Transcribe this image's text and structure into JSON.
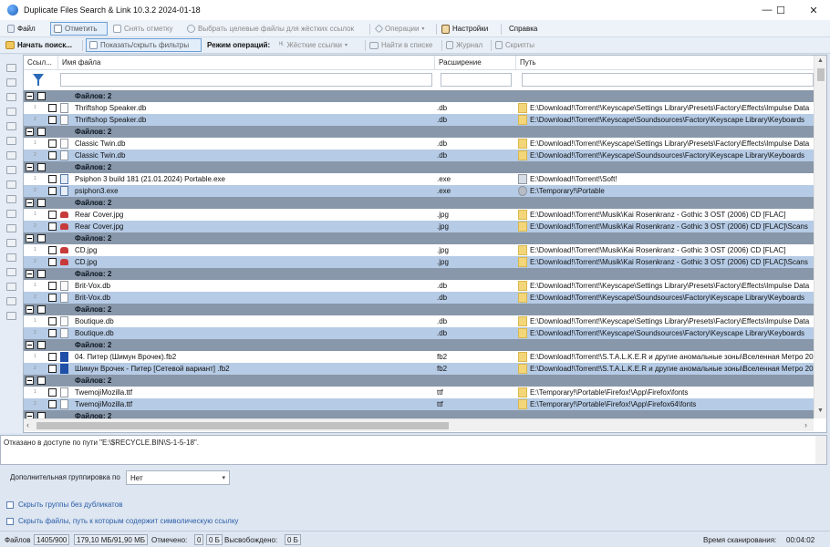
{
  "window": {
    "title": "Duplicate Files Search & Link 10.3.2 2024-01-18",
    "minimize": "—",
    "maximize": "☐",
    "close": "✕"
  },
  "menu": {
    "file": "Файл",
    "mark": "Отметить",
    "unmark": "Снять отметку",
    "select_targets": "Выбрать целевые файлы для жёстких ссылок",
    "operations": "Операции",
    "settings": "Настройки",
    "help": "Справка"
  },
  "toolbar": {
    "start_search": "Начать поиск...",
    "toggle_filters": "Показать/скрыть фильтры",
    "mode_label": "Режим операций:",
    "hard_links": "Жёсткие ссылки",
    "find_in_list": "Найти в списке",
    "journal": "Журнал",
    "scripts": "Скрипты"
  },
  "grid": {
    "columns": {
      "links": "Ссыл...",
      "filename": "Имя файла",
      "extension": "Расширение",
      "path": "Путь"
    },
    "group_label": "Файлов: 2",
    "rows": [
      {
        "type": "group",
        "label": "Файлов: 2"
      },
      {
        "type": "file",
        "num": "1",
        "icon": "db",
        "name": "Thriftshop Speaker.db",
        "ext": ".db",
        "path_icon": "folder",
        "path": "E:\\Download!\\Torrent!\\Keyscape\\Settings Library\\Presets\\Factory\\Effects\\Impulse Data"
      },
      {
        "type": "file",
        "num": "2",
        "icon": "db",
        "name": "Thriftshop Speaker.db",
        "ext": ".db",
        "path_icon": "folder",
        "path": "E:\\Download!\\Torrent!\\Keyscape\\Soundsources\\Factory\\Keyscape Library\\Keyboards"
      },
      {
        "type": "group",
        "label": "Файлов: 2"
      },
      {
        "type": "file",
        "num": "1",
        "icon": "db",
        "name": "Classic Twin.db",
        "ext": ".db",
        "path_icon": "folder",
        "path": "E:\\Download!\\Torrent!\\Keyscape\\Settings Library\\Presets\\Factory\\Effects\\Impulse Data"
      },
      {
        "type": "file",
        "num": "2",
        "icon": "db",
        "name": "Classic Twin.db",
        "ext": ".db",
        "path_icon": "folder",
        "path": "E:\\Download!\\Torrent!\\Keyscape\\Soundsources\\Factory\\Keyscape Library\\Keyboards"
      },
      {
        "type": "group",
        "label": "Файлов: 2"
      },
      {
        "type": "file",
        "num": "1",
        "icon": "exe",
        "name": "Psiphon 3 build 181 (21.01.2024) Portable.exe",
        "ext": ".exe",
        "path_icon": "app",
        "path": "E:\\Download!\\Torrent!\\Soft!"
      },
      {
        "type": "file",
        "num": "2",
        "icon": "exe",
        "name": "psiphon3.exe",
        "ext": ".exe",
        "path_icon": "gear",
        "path": "E:\\Temporary!\\Portable"
      },
      {
        "type": "group",
        "label": "Файлов: 2"
      },
      {
        "type": "file",
        "num": "1",
        "icon": "jpg",
        "name": "Rear Cover.jpg",
        "ext": ".jpg",
        "path_icon": "folder",
        "path": "E:\\Download!\\Torrent!\\Musik\\Kai Rosenkranz - Gothic 3 OST (2006) CD [FLAC]"
      },
      {
        "type": "file",
        "num": "2",
        "icon": "jpg",
        "name": "Rear Cover.jpg",
        "ext": ".jpg",
        "path_icon": "folder",
        "path": "E:\\Download!\\Torrent!\\Musik\\Kai Rosenkranz - Gothic 3 OST (2006) CD [FLAC]\\Scans"
      },
      {
        "type": "group",
        "label": "Файлов: 2"
      },
      {
        "type": "file",
        "num": "1",
        "icon": "jpg",
        "name": "CD.jpg",
        "ext": ".jpg",
        "path_icon": "folder",
        "path": "E:\\Download!\\Torrent!\\Musik\\Kai Rosenkranz - Gothic 3 OST (2006) CD [FLAC]"
      },
      {
        "type": "file",
        "num": "2",
        "icon": "jpg",
        "name": "CD.jpg",
        "ext": ".jpg",
        "path_icon": "folder",
        "path": "E:\\Download!\\Torrent!\\Musik\\Kai Rosenkranz - Gothic 3 OST (2006) CD [FLAC]\\Scans"
      },
      {
        "type": "group",
        "label": "Файлов: 2"
      },
      {
        "type": "file",
        "num": "1",
        "icon": "db",
        "name": "Brit-Vox.db",
        "ext": ".db",
        "path_icon": "folder",
        "path": "E:\\Download!\\Torrent!\\Keyscape\\Settings Library\\Presets\\Factory\\Effects\\Impulse Data"
      },
      {
        "type": "file",
        "num": "2",
        "icon": "db",
        "name": "Brit-Vox.db",
        "ext": ".db",
        "path_icon": "folder",
        "path": "E:\\Download!\\Torrent!\\Keyscape\\Soundsources\\Factory\\Keyscape Library\\Keyboards"
      },
      {
        "type": "group",
        "label": "Файлов: 2"
      },
      {
        "type": "file",
        "num": "1",
        "icon": "db",
        "name": "Boutique.db",
        "ext": ".db",
        "path_icon": "folder",
        "path": "E:\\Download!\\Torrent!\\Keyscape\\Settings Library\\Presets\\Factory\\Effects\\Impulse Data"
      },
      {
        "type": "file",
        "num": "2",
        "icon": "db",
        "name": "Boutique.db",
        "ext": ".db",
        "path_icon": "folder",
        "path": "E:\\Download!\\Torrent!\\Keyscape\\Soundsources\\Factory\\Keyscape Library\\Keyboards"
      },
      {
        "type": "group",
        "label": "Файлов: 2"
      },
      {
        "type": "file",
        "num": "1",
        "icon": "fb2",
        "name": "04. Питер (Шимун Врочек).fb2",
        "ext": "fb2",
        "path_icon": "folder",
        "path": "E:\\Download!\\Torrent!\\S.T.A.L.K.E.R и другие аномальные зоны\\Вселенная Метро 20"
      },
      {
        "type": "file",
        "num": "2",
        "icon": "fb2",
        "name": "Шимун Врочек - Питер [Сетевой вариант] .fb2",
        "ext": "fb2",
        "path_icon": "folder",
        "path": "E:\\Download!\\Torrent!\\S.T.A.L.K.E.R и другие аномальные зоны\\Вселенная Метро 20"
      },
      {
        "type": "group",
        "label": "Файлов: 2"
      },
      {
        "type": "file",
        "num": "1",
        "icon": "ttf",
        "name": "TwemojiMozilla.ttf",
        "ext": "ttf",
        "path_icon": "folder",
        "path": "E:\\Temporary!\\Portable\\Firefox!\\App\\Firefox\\fonts"
      },
      {
        "type": "file",
        "num": "2",
        "icon": "ttf",
        "name": "TwemojiMozilla.ttf",
        "ext": "ttf",
        "path_icon": "folder",
        "path": "E:\\Temporary!\\Portable\\Firefox!\\App\\Firefox64\\fonts"
      },
      {
        "type": "group",
        "label": "Файлов: 2"
      }
    ]
  },
  "message": "Отказано в доступе по пути \"E:\\$RECYCLE.BIN\\S-1-5-18\".",
  "grouping": {
    "label": "Дополнительная группировка по",
    "value": "Нет"
  },
  "options": {
    "hide_groups": "Скрыть группы без дубликатов",
    "hide_symlinks": "Скрыть файлы, путь к которым содержит символическую ссылку"
  },
  "status": {
    "files_label": "Файлов",
    "files_count": "1405/900",
    "size": "179,10 МБ/91,90 МБ",
    "marked_label": "Отмечено:",
    "marked_count": "0",
    "marked_size": "0 Б",
    "freed_label": "Высвобождено:",
    "freed_size": "0 Б",
    "scan_time_label": "Время сканирования:",
    "scan_time": "00:04:02"
  },
  "colors": {
    "group_row": "#8897a9",
    "alt_row": "#b6cbe5",
    "accent": "#2a6ab8"
  }
}
